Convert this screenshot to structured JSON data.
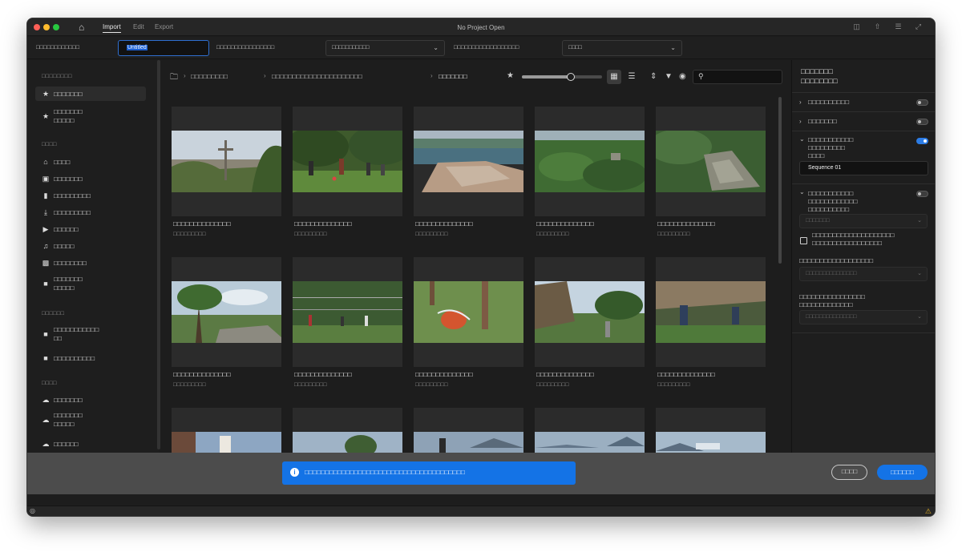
{
  "window": {
    "title": "No Project Open"
  },
  "tabs": [
    "Import",
    "Edit",
    "Export"
  ],
  "toolbar": {
    "project_name_label": "□□□□□□□□□□□□",
    "project_name_value": "Untitled",
    "location_label": "□□□□□□□□□□□□□□□□",
    "location_value": "□□□□□□□□□□□",
    "preset_label": "□□□□□□□□□□□□□□□□□□",
    "preset_value": "□□□□"
  },
  "sidebar": {
    "favorites_header": "□□□□□□□□",
    "favorites": [
      {
        "icon": "star-icon",
        "label": "□□□□□□□",
        "selected": true
      },
      {
        "icon": "star-icon",
        "label": "□□□□□□□\n□□□□□",
        "selected": false
      }
    ],
    "device_header": "□□□□",
    "device": [
      {
        "icon": "home-icon",
        "label": "□□□□"
      },
      {
        "icon": "desktop-icon",
        "label": "□□□□□□□"
      },
      {
        "icon": "document-icon",
        "label": "□□□□□□□□□"
      },
      {
        "icon": "download-icon",
        "label": "□□□□□□□□□"
      },
      {
        "icon": "video-icon",
        "label": "□□□□□□"
      },
      {
        "icon": "music-icon",
        "label": "□□□□□"
      },
      {
        "icon": "image-icon",
        "label": "□□□□□□□□"
      },
      {
        "icon": "folder-icon",
        "label": "□□□□□□□\n□□□□□"
      }
    ],
    "recent_header": "□□□□□□",
    "recent": [
      {
        "icon": "folder-icon",
        "label": "□□□□□□□□□□□\n□□"
      },
      {
        "icon": "folder-icon",
        "label": "□□□□□□□□□□"
      }
    ],
    "cloud_header": "□□□□",
    "cloud": [
      {
        "icon": "cloud-icon",
        "label": "□□□□□□□"
      },
      {
        "icon": "cloud-icon",
        "label": "□□□□□□□\n□□□□□"
      },
      {
        "icon": "cloud-icon",
        "label": "□□□□□□"
      }
    ]
  },
  "breadcrumb": [
    "□□□□□□□□□",
    "□□□□□□□□□□□□□□□□□□□□□□",
    "□□□□□□□"
  ],
  "media": [
    {
      "title": "□□□□□□□□□□□□□□",
      "meta": "□□□□□□□□□"
    },
    {
      "title": "□□□□□□□□□□□□□□",
      "meta": "□□□□□□□□□"
    },
    {
      "title": "□□□□□□□□□□□□□□",
      "meta": "□□□□□□□□□"
    },
    {
      "title": "□□□□□□□□□□□□□□",
      "meta": "□□□□□□□□□"
    },
    {
      "title": "□□□□□□□□□□□□□□",
      "meta": "□□□□□□□□□"
    },
    {
      "title": "□□□□□□□□□□□□□□",
      "meta": "□□□□□□□□□"
    },
    {
      "title": "□□□□□□□□□□□□□□",
      "meta": "□□□□□□□□□"
    },
    {
      "title": "□□□□□□□□□□□□□□",
      "meta": "□□□□□□□□□"
    },
    {
      "title": "□□□□□□□□□□□□□□",
      "meta": "□□□□□□□□□"
    },
    {
      "title": "□□□□□□□□□□□□□□",
      "meta": "□□□□□□□□□"
    },
    {
      "title": "",
      "meta": ""
    },
    {
      "title": "",
      "meta": ""
    },
    {
      "title": "",
      "meta": ""
    },
    {
      "title": "",
      "meta": ""
    },
    {
      "title": "",
      "meta": ""
    }
  ],
  "right_panel": {
    "title": "□□□□□□□\n□□□□□□□□",
    "row1_label": "□□□□□□□□□□",
    "row2_label": "□□□□□□□",
    "row3_label": "□□□□□□□□□□□\n□□□□□□□□□\n□□□□",
    "sequence_name": "Sequence 01",
    "row4_label": "□□□□□□□□□□□\n□□□□□□□□□□□□\n□□□□□□□□□□",
    "dd1_value": "□□□□□□□",
    "checkbox_label": "□□□□□□□□□□□□□□□□□□□□\n□□□□□□□□□□□□□□□□□",
    "label2": "□□□□□□□□□□□□□□□□□□",
    "dd2_value": "□□□□□□□□□□□□□□□",
    "label3": "□□□□□□□□□□□□□□□□\n□□□□□□□□□□□□□",
    "dd3_value": "□□□□□□□□□□□□□□□"
  },
  "footer": {
    "toast": "□□□□□□□□□□□□□□□□□□□□□□□□□□□□□□□□□□□□□□□",
    "cancel_label": "□□□□",
    "import_label": "□□□□□□"
  },
  "colors": {
    "accent": "#1473e6",
    "panel": "#1e1e1e",
    "footer": "#4c4c4c"
  }
}
